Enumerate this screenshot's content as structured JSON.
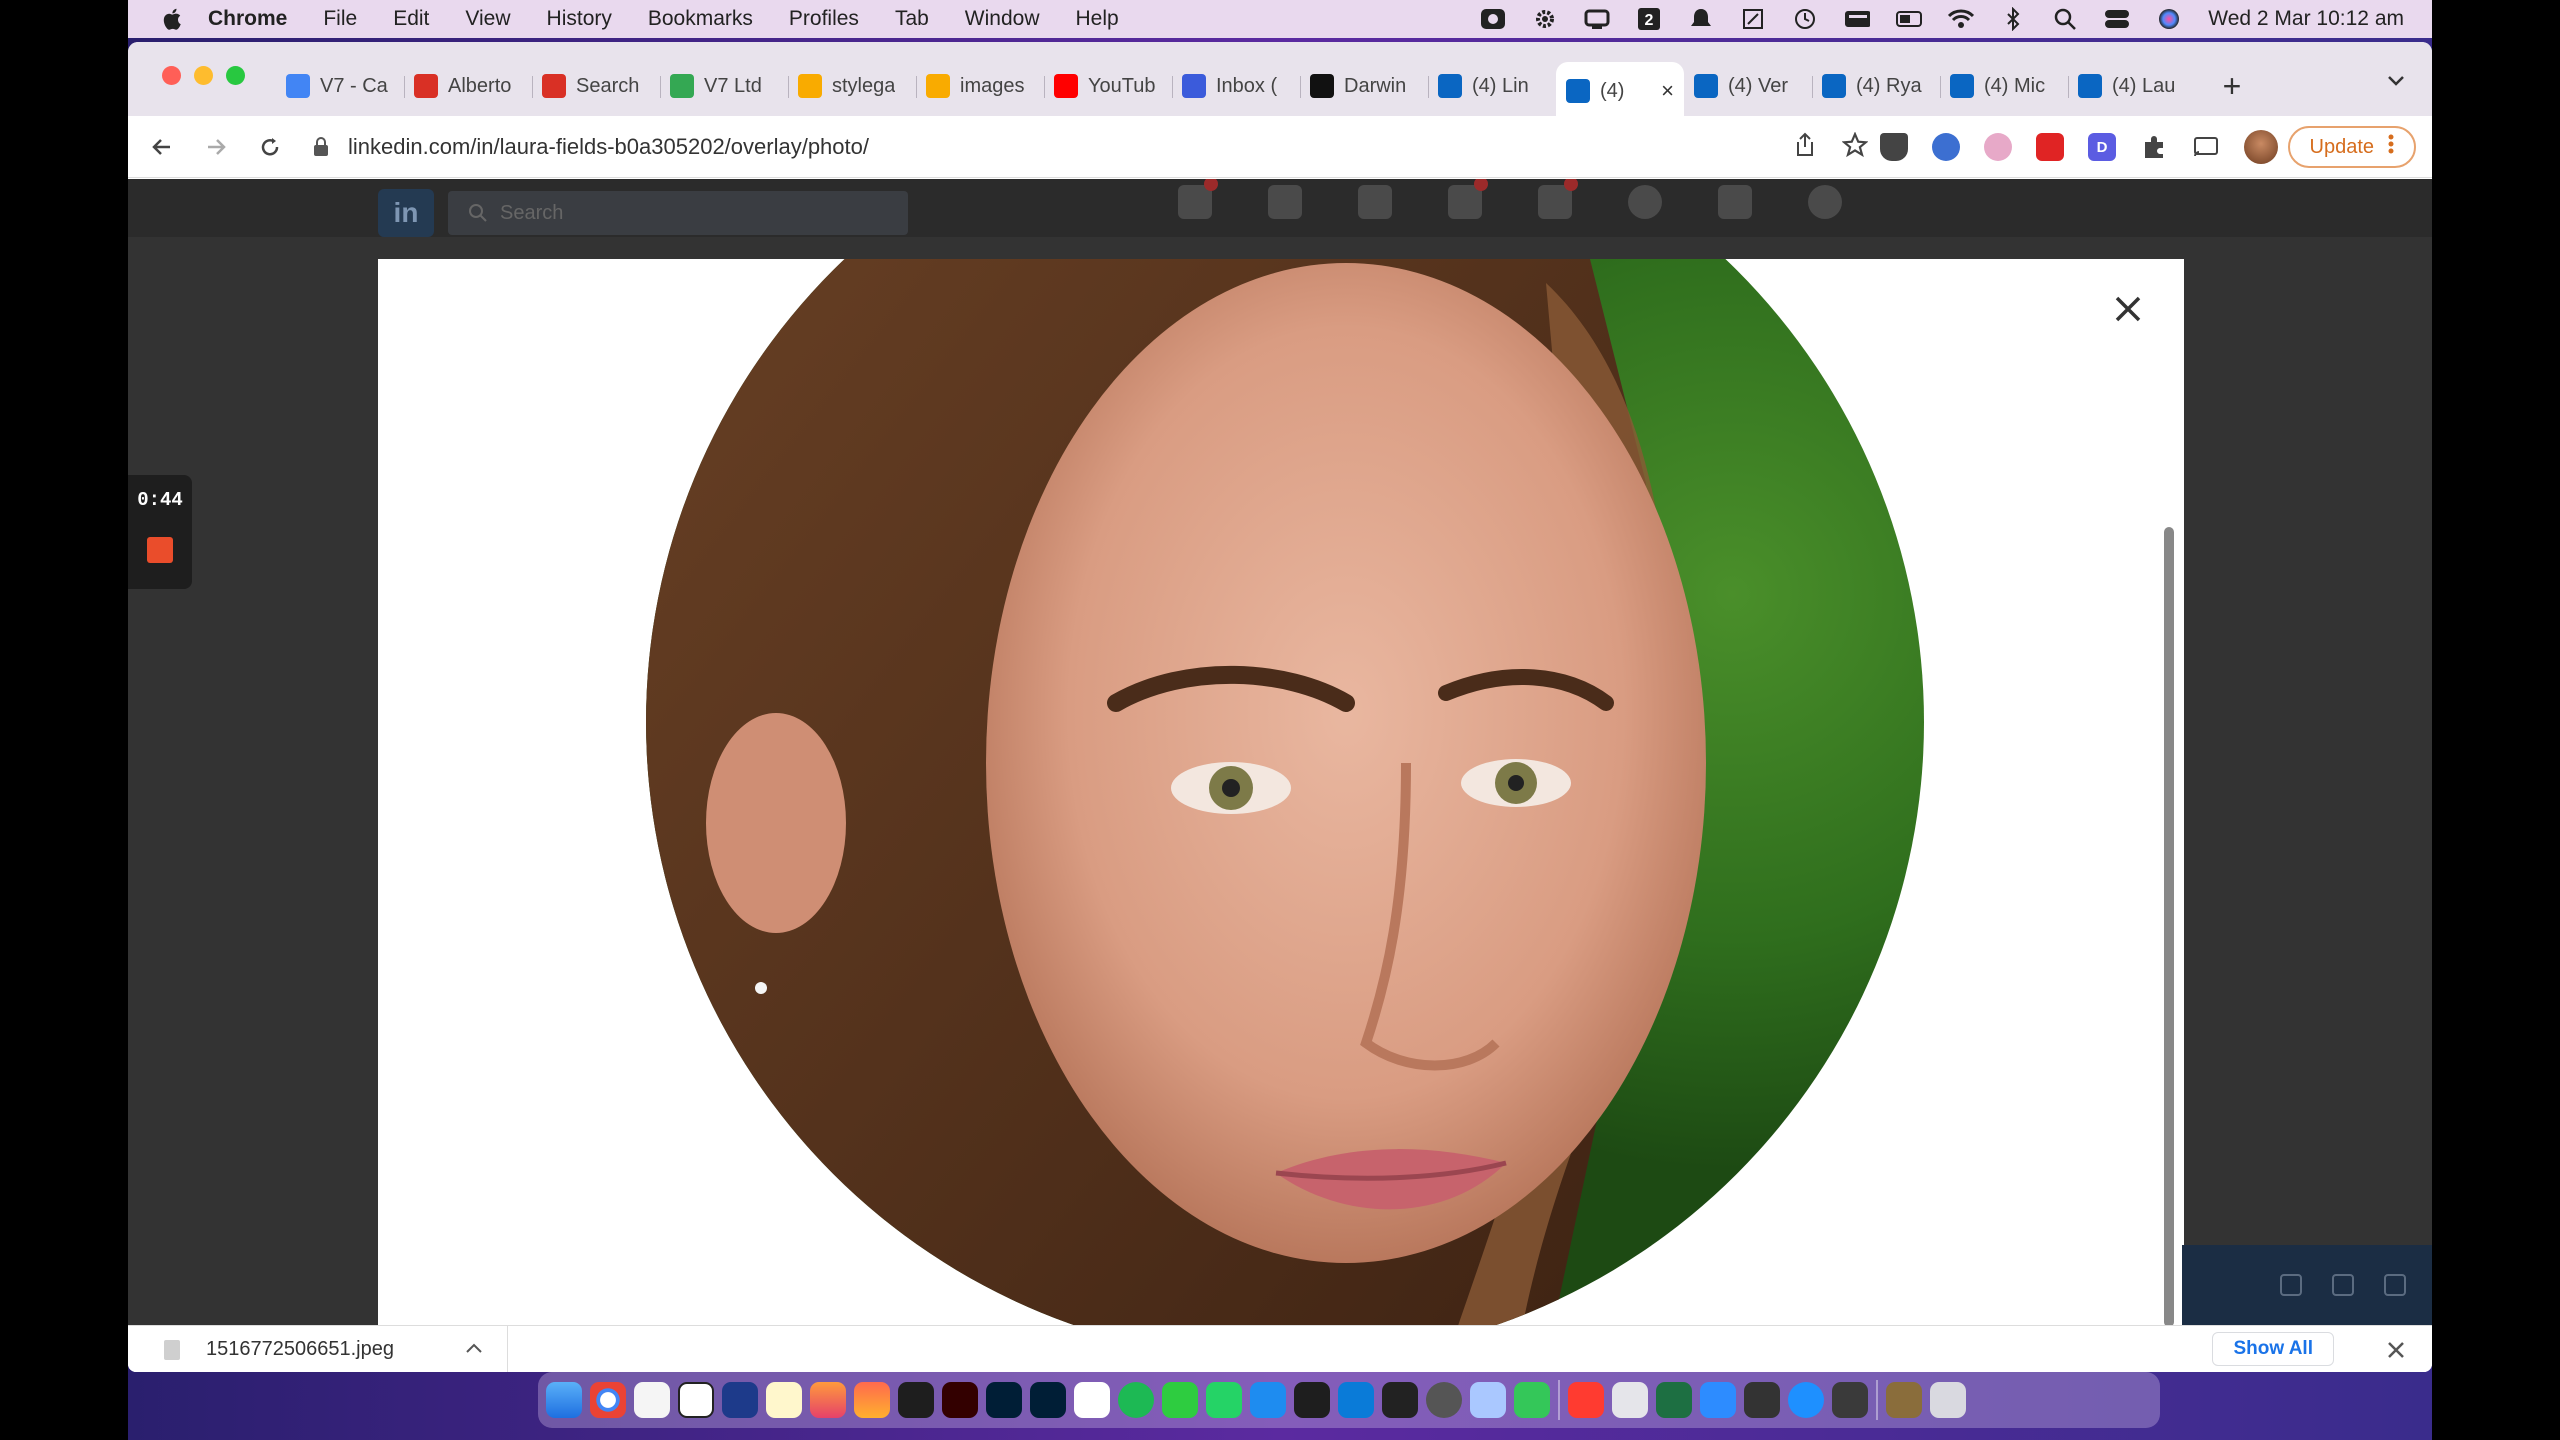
{
  "menubar": {
    "app_name": "Chrome",
    "items": [
      "File",
      "Edit",
      "View",
      "History",
      "Bookmarks",
      "Profiles",
      "Tab",
      "Window",
      "Help"
    ],
    "clock": "Wed 2 Mar  10:12 am",
    "status_icons": [
      "screen-record-icon",
      "gear-icon",
      "display-icon",
      "calendar-2-icon",
      "notification-bell-icon",
      "crop-icon",
      "time-machine-icon",
      "keyboard-icon",
      "battery-icon",
      "wifi-icon",
      "bluetooth-icon",
      "spotlight-search-icon",
      "control-center-icon",
      "siri-icon"
    ]
  },
  "tabs": [
    {
      "title": "V7 - Ca",
      "icon": "calendar-icon",
      "color": "#4285f4"
    },
    {
      "title": "Alberto",
      "icon": "gmail-icon",
      "color": "#d93025"
    },
    {
      "title": "Search",
      "icon": "gmail-icon",
      "color": "#d93025"
    },
    {
      "title": "V7 Ltd",
      "icon": "sheets-icon",
      "color": "#34a853"
    },
    {
      "title": "stylega",
      "icon": "drive-icon",
      "color": "#f9ab00"
    },
    {
      "title": "images",
      "icon": "drive-icon",
      "color": "#f9ab00"
    },
    {
      "title": "YouTub",
      "icon": "youtube-icon",
      "color": "#ff0000"
    },
    {
      "title": "Inbox (",
      "icon": "inbox-icon",
      "color": "#3b5bdb"
    },
    {
      "title": "Darwin",
      "icon": "v7-icon",
      "color": "#111111"
    },
    {
      "title": "(4) Lin",
      "icon": "linkedin-icon",
      "color": "#0a66c2"
    },
    {
      "title": "(4)",
      "icon": "linkedin-icon",
      "color": "#0a66c2",
      "active": true
    },
    {
      "title": "(4) Ver",
      "icon": "linkedin-icon",
      "color": "#0a66c2"
    },
    {
      "title": "(4) Rya",
      "icon": "linkedin-icon",
      "color": "#0a66c2"
    },
    {
      "title": "(4) Mic",
      "icon": "linkedin-icon",
      "color": "#0a66c2"
    },
    {
      "title": "(4) Lau",
      "icon": "linkedin-icon",
      "color": "#0a66c2"
    }
  ],
  "toolbar": {
    "url": "linkedin.com/in/laura-fields-b0a305202/overlay/photo/",
    "update_label": "Update"
  },
  "linkedin": {
    "logo": "in",
    "search_placeholder": "Search"
  },
  "recorder": {
    "time": "0:44"
  },
  "downloads": {
    "filename": "1516772506651.jpeg",
    "show_all": "Show All"
  },
  "colors": {
    "linkedin_blue": "#0a66c2",
    "update_orange": "#d66d1d",
    "record_red": "#ea4d2b"
  }
}
